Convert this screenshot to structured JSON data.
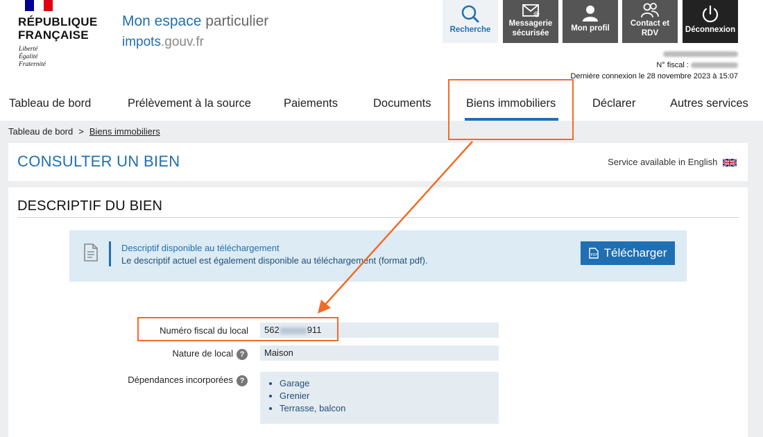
{
  "header": {
    "rf_name": [
      "RÉPUBLIQUE",
      "FRANÇAISE"
    ],
    "rf_motto": [
      "Liberté",
      "Égalité",
      "Fraternité"
    ],
    "espace_title_part1": "Mon espace",
    "espace_title_part2": "particulier",
    "site_part1": "impots",
    "site_part2": ".gouv.fr",
    "tools": [
      {
        "label": "Recherche",
        "icon": "search-icon"
      },
      {
        "label1": "Messagerie",
        "label2": "sécurisée",
        "icon": "envelope-icon"
      },
      {
        "label": "Mon profil",
        "icon": "user-icon"
      },
      {
        "label1": "Contact et",
        "label2": "RDV",
        "icon": "contact-icon"
      },
      {
        "label": "Déconnexion",
        "icon": "power-icon"
      }
    ],
    "user": {
      "fiscal_label": "N° fiscal :",
      "last_login": "Dernière connexion le 28 novembre 2023 à 15:07"
    }
  },
  "nav": {
    "items": [
      "Tableau de bord",
      "Prélèvement à la source",
      "Paiements",
      "Documents",
      "Biens immobiliers",
      "Déclarer",
      "Autres services"
    ],
    "active": "Biens immobiliers"
  },
  "breadcrumb": {
    "root": "Tableau de bord",
    "separator": ">",
    "current": "Biens immobiliers"
  },
  "consult": {
    "title": "CONSULTER UN BIEN",
    "english_link": "Service available in English"
  },
  "descriptif": {
    "title": "DESCRIPTIF DU BIEN",
    "download": {
      "line1": "Descriptif disponible au téléchargement",
      "line2": "Le descriptif actuel est également disponible au téléchargement (format pdf).",
      "button": "Télécharger"
    },
    "fields": {
      "numero_label": "Numéro fiscal du local",
      "numero_prefix": "562",
      "numero_suffix": "911",
      "nature_label": "Nature de local",
      "nature_value": "Maison",
      "dependances_label": "Dépendances incorporées",
      "dependances": [
        "Garage",
        "Grenier",
        "Terrasse, balcon"
      ]
    }
  },
  "colors": {
    "brand_blue": "#1f6fb2",
    "annotation_orange": "#f26b25",
    "flag_blue": "#000091",
    "flag_red": "#e1000f"
  }
}
